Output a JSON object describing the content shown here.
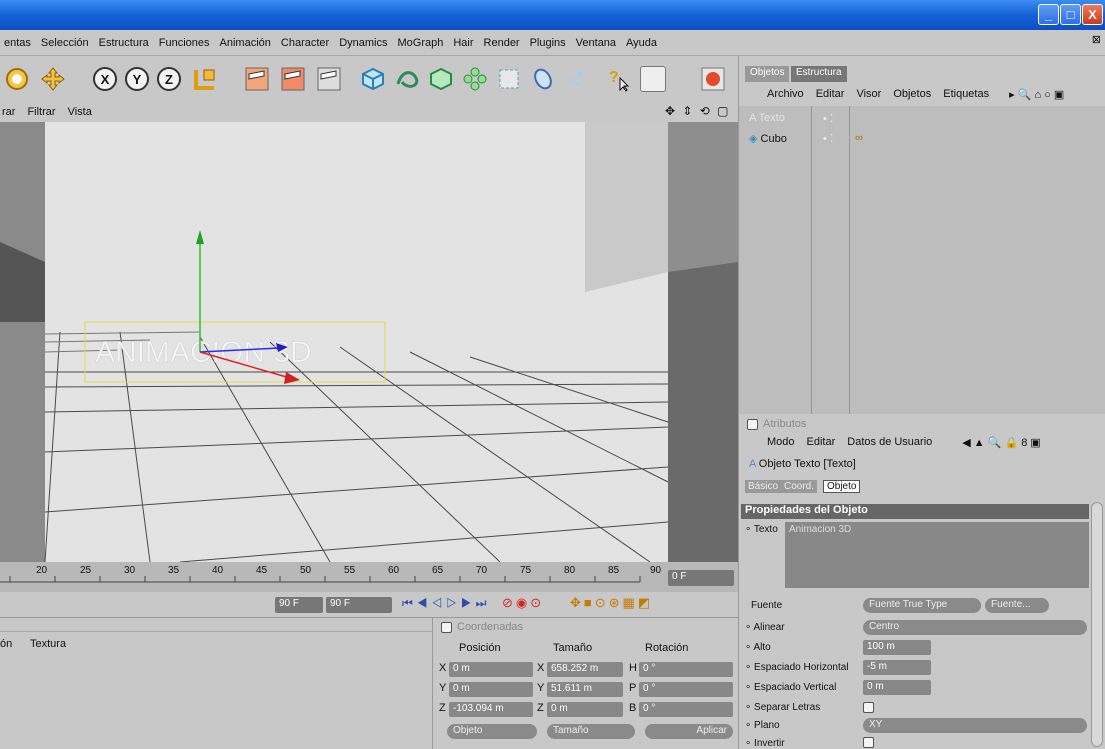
{
  "window": {
    "min": "_",
    "max": "□",
    "close": "X"
  },
  "menu": [
    "entas",
    "Selección",
    "Estructura",
    "Funciones",
    "Animación",
    "Character",
    "Dynamics",
    "MoGraph",
    "Hair",
    "Render",
    "Plugins",
    "Ventana",
    "Ayuda"
  ],
  "toolbar_letters": {
    "x": "X",
    "y": "Y",
    "z": "Z"
  },
  "viewport_menu": [
    "rar",
    "Filtrar",
    "Vista"
  ],
  "viewport_text": "ANIMACION 3D",
  "timeline_ticks": [
    "20",
    "25",
    "30",
    "35",
    "40",
    "45",
    "50",
    "55",
    "60",
    "65",
    "70",
    "75",
    "80",
    "85",
    "90"
  ],
  "timeline_frame": "0 F",
  "transport": {
    "end_frame": "90 F",
    "max_frame": "90 F"
  },
  "materials": {
    "col1": "ón",
    "col2": "Textura"
  },
  "coords": {
    "title": "Coordenadas",
    "headers": [
      "Posición",
      "Tamaño",
      "Rotación"
    ],
    "rows": [
      {
        "axis": "X",
        "pos": "0 m",
        "size_axis": "X",
        "size": "658.252 m",
        "rot_axis": "H",
        "rot": "0 °"
      },
      {
        "axis": "Y",
        "pos": "0 m",
        "size_axis": "Y",
        "size": "51.611 m",
        "rot_axis": "P",
        "rot": "0 °"
      },
      {
        "axis": "Z",
        "pos": "-103.094 m",
        "size_axis": "Z",
        "size": "0 m",
        "rot_axis": "B",
        "rot": "0 °"
      }
    ],
    "btn_objeto": "Objeto",
    "btn_tamano": "Tamaño",
    "btn_aplicar": "Aplicar"
  },
  "objects": {
    "tabs": [
      "Objetos",
      "Estructura"
    ],
    "menu": [
      "Archivo",
      "Editar",
      "Visor",
      "Objetos",
      "Etiquetas"
    ],
    "items": [
      "Texto",
      "Cubo"
    ]
  },
  "attributes": {
    "title": "Atributos",
    "menu": [
      "Modo",
      "Editar",
      "Datos de Usuario"
    ],
    "object_title": "Objeto Texto [Texto]",
    "tabs": [
      "Básico",
      "Coord.",
      "Objeto"
    ],
    "section": "Propiedades del Objeto",
    "texto_label": "Texto",
    "texto_value": "Animacion 3D",
    "fuente_label": "Fuente",
    "fuente_type": "Fuente True Type",
    "fuente_btn": "Fuente...",
    "alinear_label": "Alinear",
    "alinear_value": "Centro",
    "alto_label": "Alto",
    "alto_value": "100 m",
    "esp_h_label": "Espaciado Horizontal",
    "esp_h_value": "-5 m",
    "esp_v_label": "Espaciado Vertical",
    "esp_v_value": "0 m",
    "separar_label": "Separar Letras",
    "plano_label": "Plano",
    "plano_value": "XY",
    "invertir_label": "Invertir"
  }
}
